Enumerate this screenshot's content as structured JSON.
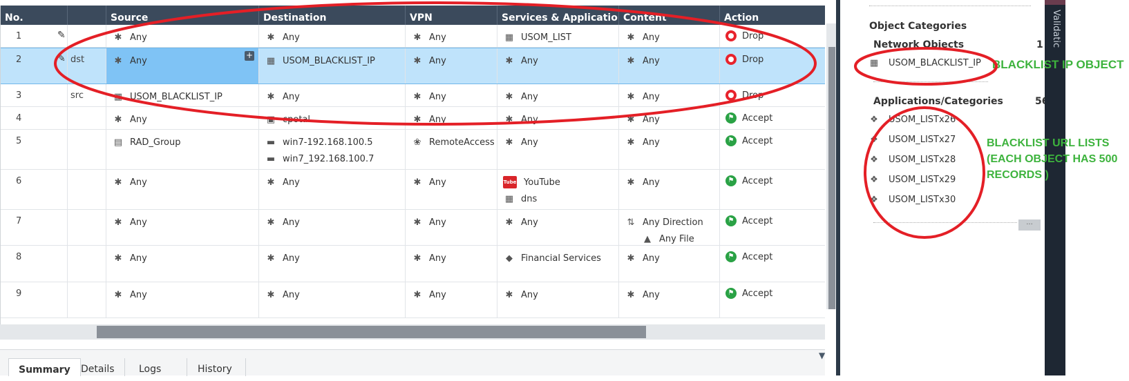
{
  "columns": [
    "No.",
    "Source",
    "Destination",
    "VPN",
    "Services & Applications",
    "Content",
    "Action"
  ],
  "rows": [
    {
      "no": "1",
      "tag": "",
      "selected": false,
      "source": [
        {
          "icon": "asterisk-icon",
          "text": "Any"
        }
      ],
      "destination": [
        {
          "icon": "asterisk-icon",
          "text": "Any"
        }
      ],
      "vpn": [
        {
          "icon": "asterisk-icon",
          "text": "Any"
        }
      ],
      "services": [
        {
          "icon": "list-object-icon",
          "text": "USOM_LIST"
        }
      ],
      "content": [
        {
          "icon": "asterisk-icon",
          "text": "Any"
        }
      ],
      "action": {
        "type": "drop",
        "text": "Drop"
      }
    },
    {
      "no": "2",
      "tag": "dst",
      "selected": true,
      "source": [
        {
          "icon": "asterisk-icon",
          "text": "Any"
        }
      ],
      "destination": [
        {
          "icon": "list-object-icon",
          "text": "USOM_BLACKLIST_IP"
        }
      ],
      "vpn": [
        {
          "icon": "asterisk-icon",
          "text": "Any"
        }
      ],
      "services": [
        {
          "icon": "asterisk-icon",
          "text": "Any"
        }
      ],
      "content": [
        {
          "icon": "asterisk-icon",
          "text": "Any"
        }
      ],
      "action": {
        "type": "drop",
        "text": "Drop"
      }
    },
    {
      "no": "3",
      "tag": "src",
      "selected": false,
      "source": [
        {
          "icon": "list-object-icon",
          "text": "USOM_BLACKLIST_IP"
        }
      ],
      "destination": [
        {
          "icon": "asterisk-icon",
          "text": "Any"
        }
      ],
      "vpn": [
        {
          "icon": "asterisk-icon",
          "text": "Any"
        }
      ],
      "services": [
        {
          "icon": "asterisk-icon",
          "text": "Any"
        }
      ],
      "content": [
        {
          "icon": "asterisk-icon",
          "text": "Any"
        }
      ],
      "action": {
        "type": "drop",
        "text": "Drop"
      }
    },
    {
      "no": "4",
      "tag": "",
      "selected": false,
      "source": [
        {
          "icon": "asterisk-icon",
          "text": "Any"
        }
      ],
      "destination": [
        {
          "icon": "portal-icon",
          "text": "cpotal"
        }
      ],
      "vpn": [
        {
          "icon": "asterisk-icon",
          "text": "Any"
        }
      ],
      "services": [
        {
          "icon": "asterisk-icon",
          "text": "Any"
        }
      ],
      "content": [
        {
          "icon": "asterisk-icon",
          "text": "Any"
        }
      ],
      "action": {
        "type": "accept",
        "text": "Accept"
      }
    },
    {
      "no": "5",
      "tag": "",
      "selected": false,
      "source": [
        {
          "icon": "user-group-icon",
          "text": "RAD_Group"
        }
      ],
      "destination": [
        {
          "icon": "host-icon",
          "text": "win7-192.168.100.5"
        },
        {
          "icon": "host-icon",
          "text": "win7_192.168.100.7"
        }
      ],
      "vpn": [
        {
          "icon": "remote-access-icon",
          "text": "RemoteAccess"
        }
      ],
      "services": [
        {
          "icon": "asterisk-icon",
          "text": "Any"
        }
      ],
      "content": [
        {
          "icon": "asterisk-icon",
          "text": "Any"
        }
      ],
      "action": {
        "type": "accept",
        "text": "Accept"
      }
    },
    {
      "no": "6",
      "tag": "",
      "selected": false,
      "source": [
        {
          "icon": "asterisk-icon",
          "text": "Any"
        }
      ],
      "destination": [
        {
          "icon": "asterisk-icon",
          "text": "Any"
        }
      ],
      "vpn": [
        {
          "icon": "asterisk-icon",
          "text": "Any"
        }
      ],
      "services": [
        {
          "icon": "youtube-icon",
          "text": "YouTube"
        },
        {
          "icon": "list-object-icon",
          "text": "dns"
        }
      ],
      "content": [
        {
          "icon": "asterisk-icon",
          "text": "Any"
        }
      ],
      "action": {
        "type": "accept",
        "text": "Accept"
      }
    },
    {
      "no": "7",
      "tag": "",
      "selected": false,
      "source": [
        {
          "icon": "asterisk-icon",
          "text": "Any"
        }
      ],
      "destination": [
        {
          "icon": "asterisk-icon",
          "text": "Any"
        }
      ],
      "vpn": [
        {
          "icon": "asterisk-icon",
          "text": "Any"
        }
      ],
      "services": [
        {
          "icon": "asterisk-icon",
          "text": "Any"
        }
      ],
      "content": [
        {
          "icon": "direction-icon",
          "text": "Any Direction"
        },
        {
          "icon": "file-type-icon",
          "text": "Any File"
        }
      ],
      "action": {
        "type": "accept",
        "text": "Accept"
      }
    },
    {
      "no": "8",
      "tag": "",
      "selected": false,
      "source": [
        {
          "icon": "asterisk-icon",
          "text": "Any"
        }
      ],
      "destination": [
        {
          "icon": "asterisk-icon",
          "text": "Any"
        }
      ],
      "vpn": [
        {
          "icon": "asterisk-icon",
          "text": "Any"
        }
      ],
      "services": [
        {
          "icon": "category-tag-icon",
          "text": "Financial Services"
        }
      ],
      "content": [
        {
          "icon": "asterisk-icon",
          "text": "Any"
        }
      ],
      "action": {
        "type": "accept",
        "text": "Accept"
      }
    },
    {
      "no": "9",
      "tag": "",
      "selected": false,
      "source": [
        {
          "icon": "asterisk-icon",
          "text": "Any"
        }
      ],
      "destination": [
        {
          "icon": "asterisk-icon",
          "text": "Any"
        }
      ],
      "vpn": [
        {
          "icon": "asterisk-icon",
          "text": "Any"
        }
      ],
      "services": [
        {
          "icon": "asterisk-icon",
          "text": "Any"
        }
      ],
      "content": [
        {
          "icon": "asterisk-icon",
          "text": "Any"
        }
      ],
      "action": {
        "type": "accept",
        "text": "Accept"
      }
    }
  ],
  "tabs": [
    "Summary",
    "Details",
    "Logs",
    "History"
  ],
  "active_tab": "Summary",
  "panel": {
    "title": "Object Categories",
    "network_objects": {
      "label": "Network Objects",
      "count": "1",
      "items": [
        "USOM_BLACKLIST_IP"
      ]
    },
    "applications": {
      "label": "Applications/Categories",
      "count": "56",
      "items": [
        "USOM_LISTx26",
        "USOM_LISTx27",
        "USOM_LISTx28",
        "USOM_LISTx29",
        "USOM_LISTx30"
      ]
    },
    "side_tab": "Validatic"
  },
  "annotations": {
    "ip_object": "BLACKLIST IP OBJECT",
    "url_lists_1": "BLACKLIST URL LISTS",
    "url_lists_2": "(EACH OBJECT HAS 500",
    "url_lists_3": "RECORDS )",
    "color": "#3db33d",
    "ellipse_color": "#e41f26"
  },
  "colors": {
    "header": "#3b4a5c",
    "selected_row": "#bfe3fb",
    "selected_cell": "#7fc3f5",
    "drop": "#e8232d",
    "accept": "#2aa245"
  }
}
